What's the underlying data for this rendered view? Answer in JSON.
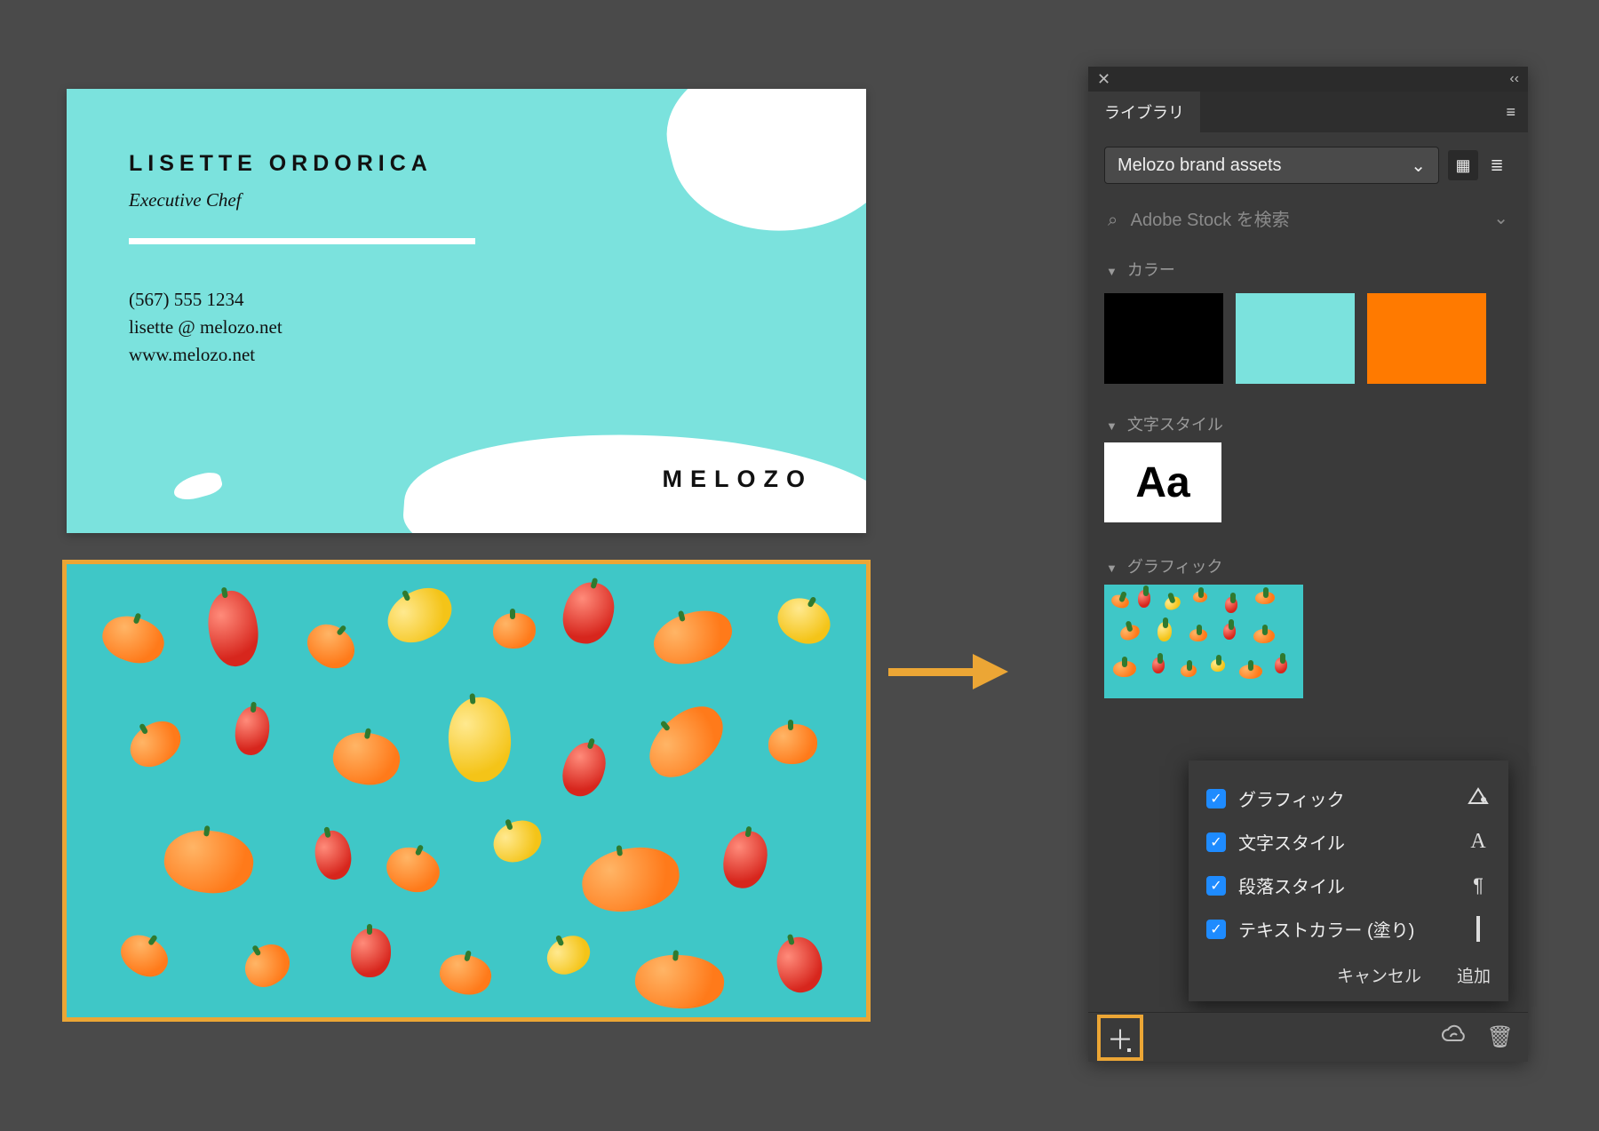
{
  "bizcard": {
    "name": "LISETTE ORDORICA",
    "title": "Executive Chef",
    "phone": "(567) 555 1234",
    "email": "lisette @ melozo.net",
    "web": "www.melozo.net",
    "logo": "MELOZO"
  },
  "panel": {
    "tab": "ライブラリ",
    "library_selected": "Melozo brand assets",
    "search_placeholder": "Adobe Stock を検索",
    "sections": {
      "color": "カラー",
      "type": "文字スタイル",
      "graphic": "グラフィック"
    },
    "type_sample": "Aa",
    "swatches": {
      "c1": "#000000",
      "c2": "#7be2dd",
      "c3": "#ff7a00"
    }
  },
  "popup": {
    "items": {
      "graphic": "グラフィック",
      "charstyle": "文字スタイル",
      "parastyle": "段落スタイル",
      "textcolor": "テキストカラー (塗り)"
    },
    "cancel": "キャンセル",
    "add": "追加"
  },
  "icons": {
    "close": "✕",
    "collapse": "‹‹",
    "menu": "≡",
    "chevron": "⌄",
    "grid": "▦",
    "list": "≣",
    "search": "⌕",
    "triangle": "▼",
    "check": "✓",
    "type_A": "A",
    "pilcrow": "¶",
    "plus": "＋",
    "cloud": "☁",
    "trash": "🗑"
  }
}
